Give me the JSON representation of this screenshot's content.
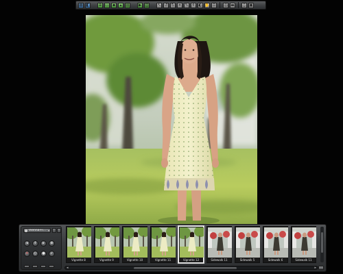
{
  "toolbar": {
    "buttons": [
      {
        "name": "tile-view-icon",
        "glyph": "▦",
        "tone": "blue"
      },
      {
        "name": "compare-view-icon",
        "glyph": "◧",
        "tone": "blue"
      },
      {
        "name": "gap"
      },
      {
        "name": "import-icon",
        "glyph": "⊕",
        "tone": "green"
      },
      {
        "name": "open-folder-icon",
        "glyph": "▭",
        "tone": "green"
      },
      {
        "name": "save-icon",
        "glyph": "▪",
        "tone": "green"
      },
      {
        "name": "export-icon",
        "glyph": "▴",
        "tone": "green"
      },
      {
        "name": "print-icon",
        "glyph": "▤",
        "tone": "green"
      },
      {
        "name": "gap"
      },
      {
        "name": "slideshow-icon",
        "glyph": "▶",
        "tone": "green"
      },
      {
        "name": "web-gallery-icon",
        "glyph": "▥",
        "tone": "green"
      },
      {
        "name": "gap"
      },
      {
        "name": "select-tool-icon",
        "glyph": "↖",
        "tone": ""
      },
      {
        "name": "rotate-left-icon",
        "glyph": "↺",
        "tone": ""
      },
      {
        "name": "rotate-right-icon",
        "glyph": "↻",
        "tone": ""
      },
      {
        "name": "crop-icon",
        "glyph": "⌗",
        "tone": ""
      },
      {
        "name": "brush-icon",
        "glyph": "✎",
        "tone": ""
      },
      {
        "name": "stamp-icon",
        "glyph": "⚘",
        "tone": ""
      },
      {
        "name": "levels-icon",
        "glyph": "◐",
        "tone": ""
      },
      {
        "name": "hand-tool-icon",
        "glyph": "✋",
        "tone": ""
      },
      {
        "name": "zoom-icon",
        "glyph": "⊙",
        "tone": ""
      },
      {
        "name": "sep"
      },
      {
        "name": "loupe-icon",
        "glyph": "◎",
        "tone": ""
      },
      {
        "name": "filmstrip-icon",
        "glyph": "▬",
        "tone": ""
      },
      {
        "name": "sep"
      },
      {
        "name": "info-panel-icon",
        "glyph": "▯",
        "tone": ""
      },
      {
        "name": "full-screen-icon",
        "glyph": "▣",
        "tone": ""
      }
    ]
  },
  "filmstrip": {
    "project_label": "Vienna-Fi…",
    "controls": {
      "row1": [
        "◂",
        "↑",
        "▸",
        "⊕"
      ],
      "row2": [
        "✕",
        "○",
        "●",
        "✓"
      ]
    },
    "thumbnails": [
      {
        "label": "Vignette 8",
        "scene": "green"
      },
      {
        "label": "Vignette 9",
        "scene": "green"
      },
      {
        "label": "Vignette 10",
        "scene": "green"
      },
      {
        "label": "Vignette 11",
        "scene": "green"
      },
      {
        "label": "Vignette 12",
        "scene": "green",
        "selected": true
      },
      {
        "label": "Sidewalk 11",
        "scene": "street"
      },
      {
        "label": "Sidewalk 5",
        "scene": "street"
      },
      {
        "label": "Sidewalk 6",
        "scene": "street"
      },
      {
        "label": "Sidewalk 11",
        "scene": "street"
      }
    ]
  },
  "colors": {
    "background": "#030303",
    "panel": "#3a3c3e",
    "selection": "#f2f2f2"
  }
}
